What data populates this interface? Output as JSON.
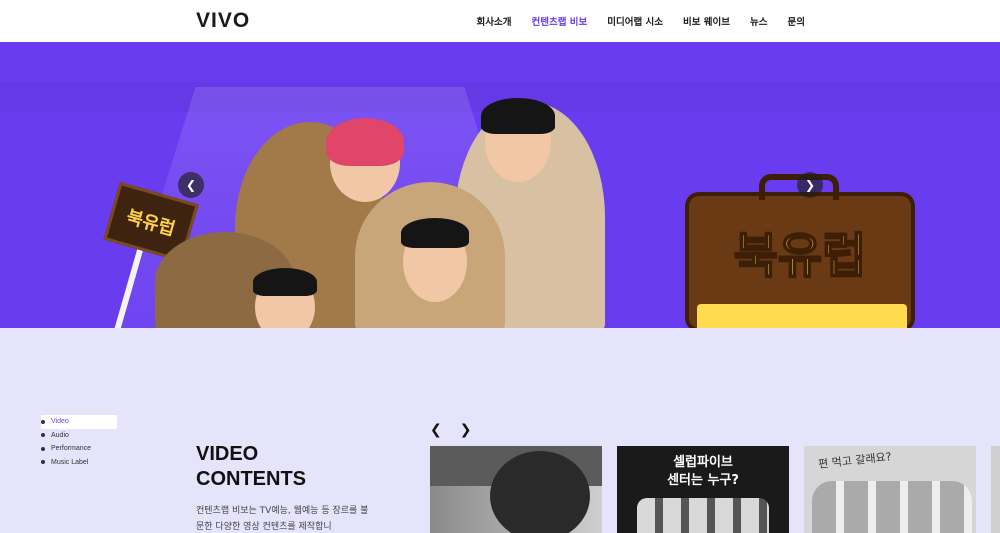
{
  "header": {
    "logo": "VIVO",
    "nav": [
      {
        "label": "회사소개",
        "active": false
      },
      {
        "label": "컨텐츠랩 비보",
        "active": true
      },
      {
        "label": "미디어랩 시소",
        "active": false
      },
      {
        "label": "비보 웨이브",
        "active": false
      },
      {
        "label": "뉴스",
        "active": false
      },
      {
        "label": "문의",
        "active": false
      }
    ]
  },
  "hero": {
    "flag_text": "북유럽",
    "suitcase_title": "북유럽",
    "colors": {
      "background": "#6a3cf0",
      "accent": "#ffcc33"
    }
  },
  "content": {
    "side_menu": [
      {
        "label": "Video",
        "active": true
      },
      {
        "label": "Audio",
        "active": false
      },
      {
        "label": "Performance",
        "active": false
      },
      {
        "label": "Music Label",
        "active": false
      }
    ],
    "title": "VIDEO\nCONTENTS",
    "description": "컨텐츠랩 비보는 TV예능, 웹예능 등 장르를 불문한 다양한 영상 컨텐츠를 제작합니",
    "thumbnails": [
      {
        "caption": ""
      },
      {
        "caption": "셀럽파이브\n센터는 누구?"
      },
      {
        "caption": "편 먹고 갈래요?"
      }
    ],
    "colors": {
      "background": "#e6e4fb",
      "active": "#6a3ee0"
    }
  }
}
